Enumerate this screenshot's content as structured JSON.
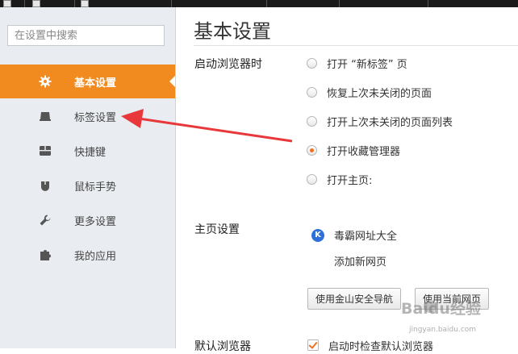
{
  "search": {
    "placeholder": "在设置中搜索"
  },
  "sidebar": {
    "items": [
      {
        "label": "基本设置",
        "icon": "gear-icon"
      },
      {
        "label": "标签设置",
        "icon": "tab-icon"
      },
      {
        "label": "快捷键",
        "icon": "keyboard-icon"
      },
      {
        "label": "鼠标手势",
        "icon": "mouse-icon"
      },
      {
        "label": "更多设置",
        "icon": "wrench-icon"
      },
      {
        "label": "我的应用",
        "icon": "puzzle-icon"
      }
    ],
    "active_index": 0
  },
  "main": {
    "title": "基本设置",
    "startup": {
      "label": "启动浏览器时",
      "options": [
        {
          "label": "打开 “新标签” 页",
          "checked": false
        },
        {
          "label": "恢复上次未关闭的页面",
          "checked": false
        },
        {
          "label": "打开上次未关闭的页面列表",
          "checked": false
        },
        {
          "label": "打开收藏管理器",
          "checked": true
        },
        {
          "label": "打开主页:",
          "checked": false
        }
      ]
    },
    "homepage": {
      "label": "主页设置",
      "site": "毒霸网址大全",
      "add_new": "添加新网页",
      "btn_nav": "使用金山安全导航",
      "btn_current": "使用当前网页"
    },
    "default_browser": {
      "label": "默认浏览器",
      "check_label": "启动时检查默认浏览器",
      "checked": true
    }
  },
  "colors": {
    "accent": "#f18a1f",
    "sidebar_bg": "#e9edf1",
    "arrow": "#e8383b"
  },
  "watermark": {
    "text": "Baidu经验",
    "url": "jingyan.baidu.com"
  }
}
